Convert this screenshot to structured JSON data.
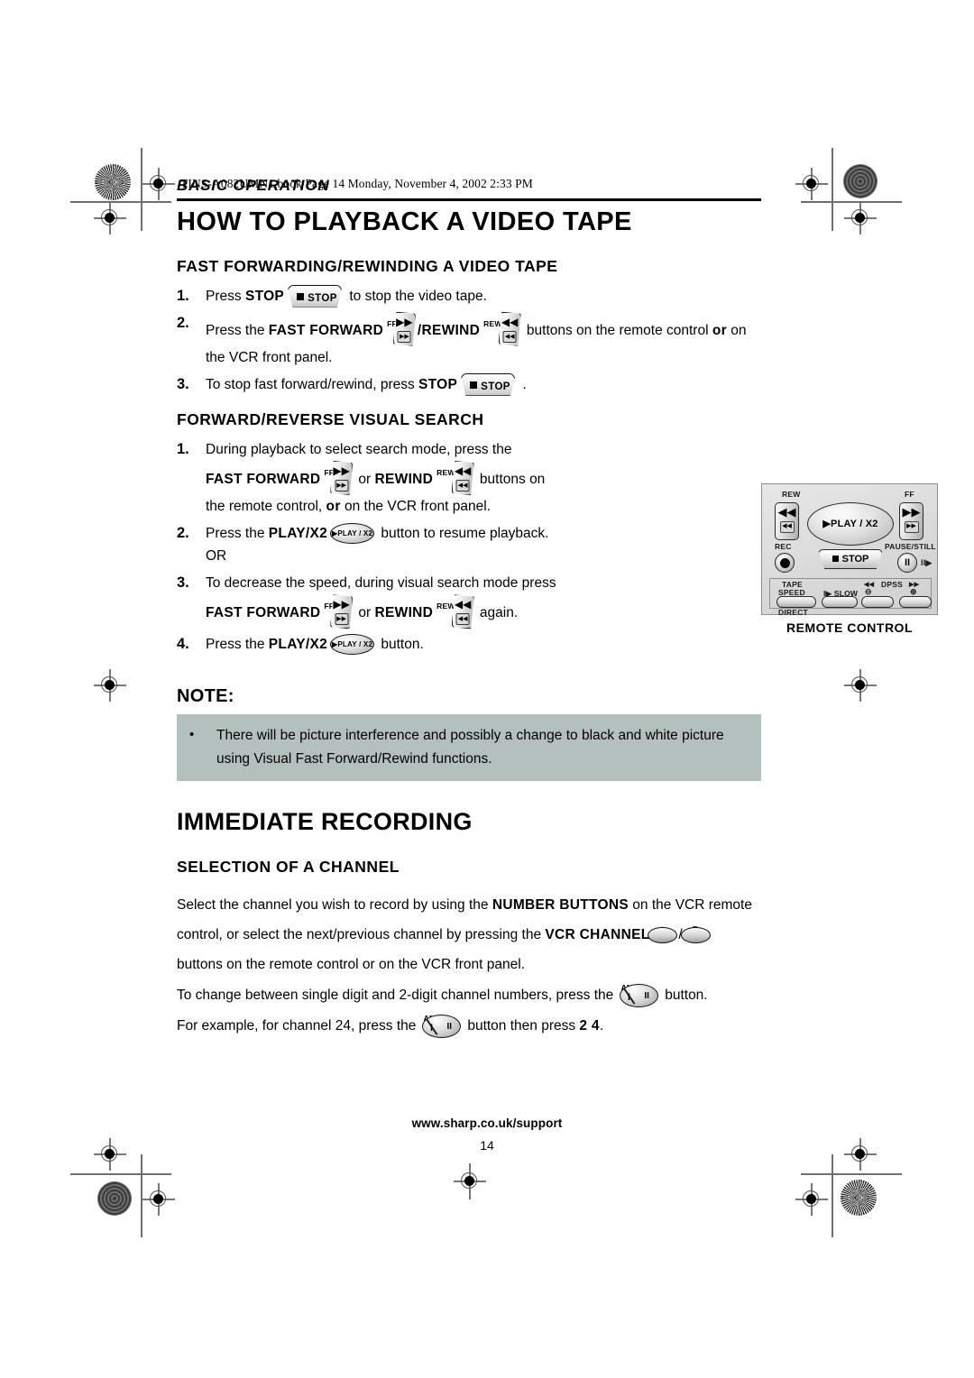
{
  "file_stamp": "TINS-A082UMN1.book  Page 14  Monday, November 4, 2002  2:33 PM",
  "header": {
    "kicker": "BASIC OPERATION",
    "title": "HOW TO PLAYBACK A VIDEO TAPE"
  },
  "section_ff": {
    "heading": "FAST FORWARDING/REWINDING A VIDEO TAPE",
    "steps": [
      {
        "num": "1.",
        "pre": "Press ",
        "bold1": "STOP",
        "post": " to stop the video tape."
      },
      {
        "num": "2.",
        "pre": "Press the ",
        "bold1": "FAST FORWARD",
        "mid": "/",
        "bold2": "REWIND",
        "post": " buttons on the remote control ",
        "bold3": "or",
        "post2": "  on the VCR front panel."
      },
      {
        "num": "3.",
        "pre": "To stop fast forward/rewind, press ",
        "bold1": "STOP",
        "post": " ."
      }
    ]
  },
  "section_vs": {
    "heading": "FORWARD/REVERSE VISUAL SEARCH",
    "steps": [
      {
        "num": "1.",
        "l1": "During playback to select search mode,  press the",
        "bold1": "FAST FORWARD",
        "conj": " or ",
        "bold2": "REWIND",
        "tail": " buttons on",
        "l3pre": "the remote control, ",
        "l3bold": "or",
        "l3post": " on the VCR front panel."
      },
      {
        "num": "2.",
        "pre": "Press the ",
        "bold1": "PLAY/X2",
        "post": " button to resume playback.",
        "or": "OR"
      },
      {
        "num": "3.",
        "l1": "To decrease the speed, during visual search mode press",
        "bold1": "FAST FORWARD",
        "conj": " or ",
        "bold2": "REWIND",
        "tail": " again."
      },
      {
        "num": "4.",
        "pre": "Press the ",
        "bold1": "PLAY/X2",
        "post": " button."
      }
    ]
  },
  "note": {
    "label": "NOTE:",
    "bullet": "•",
    "text": "There will be picture interference and possibly a change to black and white picture using Visual Fast Forward/Rewind functions."
  },
  "section_rec": {
    "title": "IMMEDIATE RECORDING",
    "heading": "SELECTION OF A CHANNEL",
    "p1_a": "Select the channel you wish to record by using the ",
    "p1_bold": "NUMBER BUTTONS",
    "p1_b": " on the VCR remote",
    "p2_a": "control, or select the next/previous channel by pressing the ",
    "p2_bold": "VCR CHANNEL",
    "p2_sep": "/",
    "p3": "buttons on the remote control or on the VCR front panel.",
    "p4_a": "To change between single digit and 2-digit channel numbers, press the ",
    "p4_b": " button.",
    "p5_a": "For example, for channel 24, press the ",
    "p5_b": " button then press ",
    "p5_bold": "2 4",
    "p5_c": "."
  },
  "buttons": {
    "stop_label": "STOP",
    "ff_cap": "FF",
    "rew_cap": "REW",
    "ff_arrow": "▶▶",
    "rew_arrow": "◀◀",
    "ff_mini": "▶▶",
    "rew_mini": "◀◀",
    "play_label": "▶PLAY / X2",
    "ampm_cap": "AM/PM",
    "ampm_left": "I",
    "ampm_right": "II",
    "chan_up": "▲",
    "chan_down": "▼"
  },
  "remote": {
    "caption": "REMOTE CONTROL",
    "rew_label": "REW",
    "ff_label": "FF",
    "rec_label": "REC",
    "pause_label": "PAUSE/STILL",
    "play_label": "▶PLAY / X2",
    "stop_label": "STOP",
    "tape_label": "TAPE",
    "speed_label": "SPEED",
    "direct_label": "DIRECT",
    "slow_label": "I▶ SLOW",
    "dpss_label": "DPSS",
    "dpss_rew": "◀◀",
    "dpss_ff": "▶▶",
    "dpss_minus": "⊖",
    "dpss_plus": "⊕",
    "pause_glyph": "II",
    "pause_frame": "II▶",
    "rew_arrow": "◀◀",
    "ff_arrow": "▶▶",
    "rew_mini": "◀◀",
    "ff_mini": "▶▶"
  },
  "footer": {
    "url": "www.sharp.co.uk/support",
    "page_number": "14"
  },
  "colors": {
    "note_background": "#b3c0bd",
    "text": "#000000",
    "remote_body": "#dcdcdc"
  }
}
